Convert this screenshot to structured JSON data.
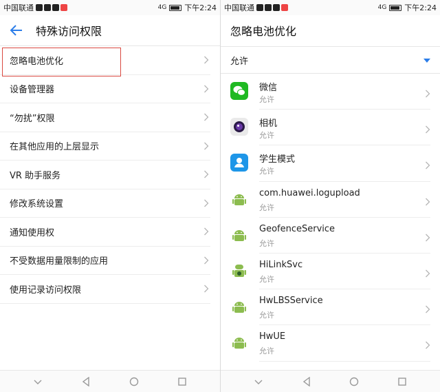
{
  "left": {
    "status": {
      "carrier": "中国联通",
      "time": "下午2:24",
      "signal_text": "4G"
    },
    "title": "特殊访问权限",
    "items": [
      {
        "label": "忽略电池优化",
        "highlighted": true
      },
      {
        "label": "设备管理器"
      },
      {
        "label": "“勿扰”权限"
      },
      {
        "label": "在其他应用的上层显示"
      },
      {
        "label": "VR 助手服务"
      },
      {
        "label": "修改系统设置"
      },
      {
        "label": "通知使用权"
      },
      {
        "label": "不受数据用量限制的应用"
      },
      {
        "label": "使用记录访问权限"
      }
    ]
  },
  "right": {
    "status": {
      "carrier": "中国联通",
      "time": "下午2:24",
      "signal_text": "4G"
    },
    "title": "忽略电池优化",
    "filter": "允许",
    "apps": [
      {
        "name": "微信",
        "status": "允许",
        "icon": "wechat-icon",
        "color": "#1fb922"
      },
      {
        "name": "相机",
        "status": "允许",
        "icon": "camera-icon",
        "color": "#6a39a8"
      },
      {
        "name": "学生模式",
        "status": "允许",
        "icon": "student-mode-icon",
        "color": "#1e96e8"
      },
      {
        "name": "com.huawei.logupload",
        "status": "允许",
        "icon": "android-icon",
        "color": "#8cbc4f"
      },
      {
        "name": "GeofenceService",
        "status": "允许",
        "icon": "android-icon",
        "color": "#8cbc4f"
      },
      {
        "name": "HiLinkSvc",
        "status": "允许",
        "icon": "android-robot-icon",
        "color": "#8cbc4f"
      },
      {
        "name": "HwLBSService",
        "status": "允许",
        "icon": "android-icon",
        "color": "#8cbc4f"
      },
      {
        "name": "HwUE",
        "status": "允许",
        "icon": "android-icon",
        "color": "#8cbc4f"
      }
    ]
  },
  "colors": {
    "accent": "#2b7de9",
    "highlight_border": "#d9473f"
  }
}
